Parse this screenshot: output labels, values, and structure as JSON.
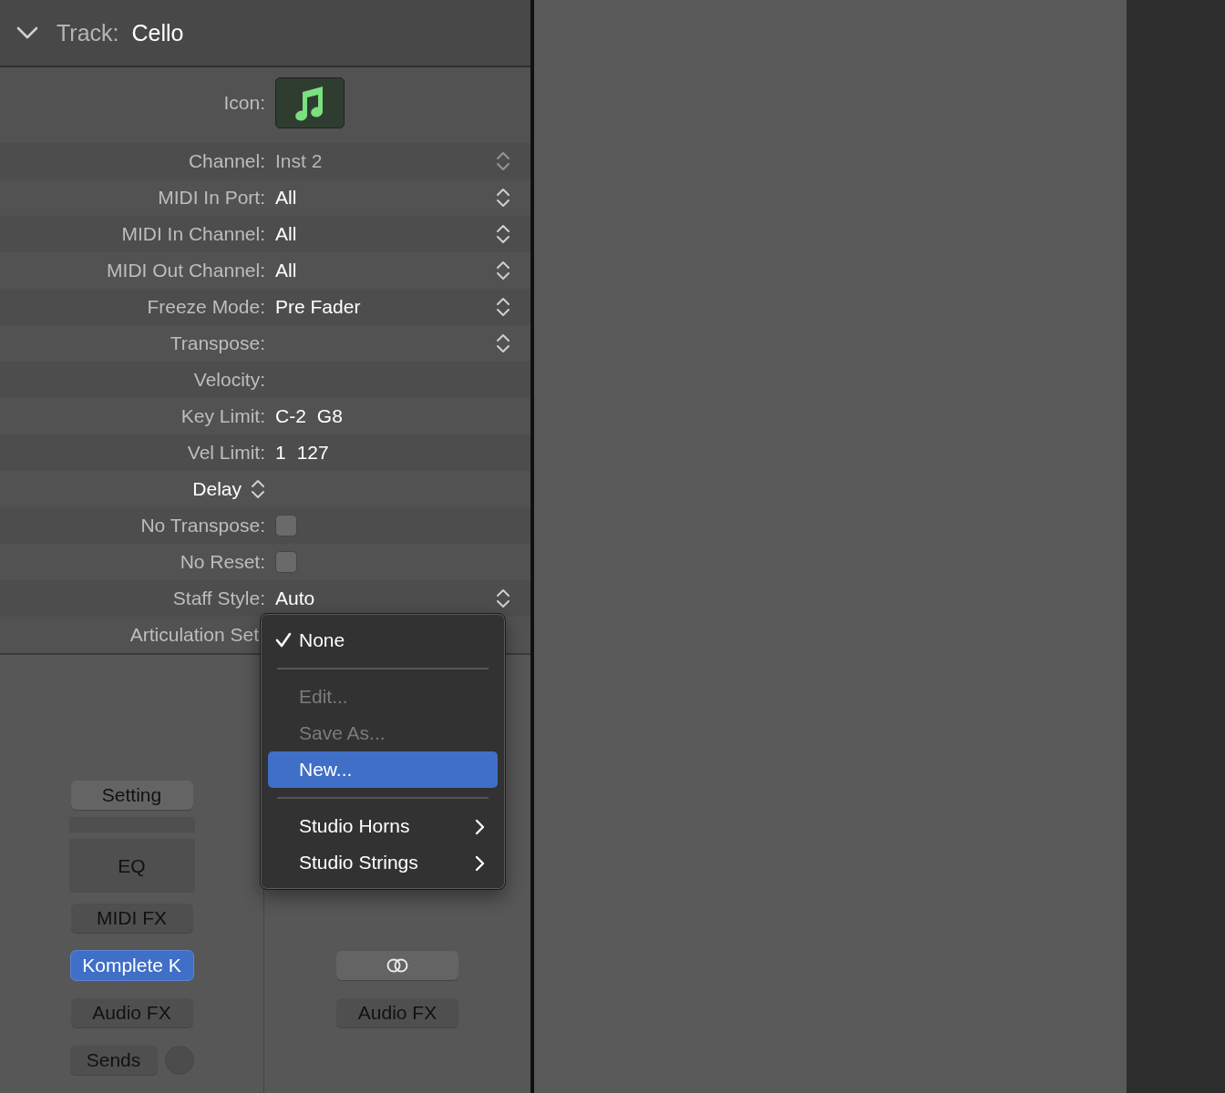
{
  "header": {
    "expanded": true,
    "label": "Track:",
    "value": "Cello"
  },
  "icon_row": {
    "label": "Icon:"
  },
  "rows": [
    {
      "kind": "popup",
      "label": "Channel:",
      "value": "Inst 2",
      "disabled": true
    },
    {
      "kind": "popup",
      "label": "MIDI In Port:",
      "value": "All",
      "disabled": false
    },
    {
      "kind": "popup",
      "label": "MIDI In Channel:",
      "value": "All",
      "disabled": false
    },
    {
      "kind": "popup",
      "label": "MIDI Out Channel:",
      "value": "All",
      "disabled": false
    },
    {
      "kind": "popup",
      "label": "Freeze Mode:",
      "value": "Pre Fader",
      "disabled": false
    },
    {
      "kind": "popup",
      "label": "Transpose:",
      "disabled": false
    },
    {
      "kind": "field",
      "label": "Velocity:"
    },
    {
      "kind": "range",
      "label": "Key Limit:",
      "values": [
        "C-2",
        "G8"
      ]
    },
    {
      "kind": "range",
      "label": "Vel Limit:",
      "values": [
        "1",
        "127"
      ]
    },
    {
      "kind": "popup-label",
      "label": "Delay"
    },
    {
      "kind": "checkbox",
      "label": "No Transpose:",
      "checked": false
    },
    {
      "kind": "checkbox",
      "label": "No Reset:",
      "checked": false
    },
    {
      "kind": "popup",
      "label": "Staff Style:",
      "value": "Auto",
      "disabled": false
    },
    {
      "kind": "covered",
      "label": "Articulation Set"
    }
  ],
  "menu": [
    {
      "kind": "item",
      "label": "None",
      "checked": true,
      "disabled": false,
      "selected": false,
      "submenu": false
    },
    {
      "kind": "separator"
    },
    {
      "kind": "item",
      "label": "Edit...",
      "checked": false,
      "disabled": true,
      "selected": false,
      "submenu": false
    },
    {
      "kind": "item",
      "label": "Save As...",
      "checked": false,
      "disabled": true,
      "selected": false,
      "submenu": false
    },
    {
      "kind": "item",
      "label": "New...",
      "checked": false,
      "disabled": false,
      "selected": true,
      "submenu": false
    },
    {
      "kind": "separator"
    },
    {
      "kind": "item",
      "label": "Studio Horns",
      "checked": false,
      "disabled": false,
      "selected": false,
      "submenu": true
    },
    {
      "kind": "item",
      "label": "Studio Strings",
      "checked": false,
      "disabled": false,
      "selected": false,
      "submenu": true
    }
  ],
  "strip_left": [
    {
      "kind": "button",
      "label": "Setting",
      "active": false
    },
    {
      "kind": "blank"
    },
    {
      "kind": "slot",
      "label": "EQ"
    },
    {
      "kind": "button",
      "label": "MIDI FX",
      "active": false
    },
    {
      "kind": "button",
      "label": "Komplete K",
      "active": true
    },
    {
      "kind": "button",
      "label": "Audio FX",
      "active": false
    },
    {
      "kind": "sends",
      "label": "Sends"
    }
  ],
  "strip_right": [
    {
      "kind": "link"
    },
    {
      "kind": "button",
      "label": "Audio FX",
      "active": false
    }
  ]
}
